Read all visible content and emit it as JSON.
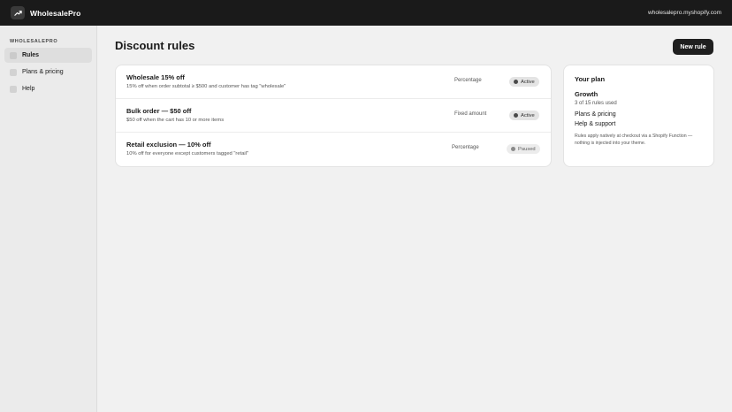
{
  "app": {
    "brand": "WholesalePro",
    "store_domain": "wholesalepro.myshopify.com",
    "logo_icon": "trend-up-icon"
  },
  "sidebar": {
    "heading": "WHOLESALEPRO",
    "items": [
      {
        "label": "Rules",
        "active": true
      },
      {
        "label": "Plans & pricing",
        "active": false
      },
      {
        "label": "Help",
        "active": false
      }
    ]
  },
  "page": {
    "title": "Discount rules",
    "new_button_label": "New rule"
  },
  "rules": [
    {
      "title": "Wholesale 15% off",
      "description": "15% off when order subtotal ≥ $500 and customer has tag \"wholesale\"",
      "type": "Percentage",
      "status": "Active"
    },
    {
      "title": "Bulk order — $50 off",
      "description": "$50 off when the cart has 10 or more items",
      "type": "Fixed amount",
      "status": "Active"
    },
    {
      "title": "Retail exclusion — 10% off",
      "description": "10% off for everyone except customers tagged \"retail\"",
      "type": "Percentage",
      "status": "Paused"
    }
  ],
  "plan": {
    "heading": "Your plan",
    "name": "Growth",
    "usage": "3 of 15 rules used",
    "link_pricing": "Plans & pricing",
    "link_help": "Help & support",
    "note": "Rules apply natively at checkout via a Shopify Function — nothing is injected into your theme."
  },
  "colors": {
    "topbar": "#1a1a1a",
    "accent_button": "#1f1f1f",
    "background": "#f1f1f1"
  }
}
